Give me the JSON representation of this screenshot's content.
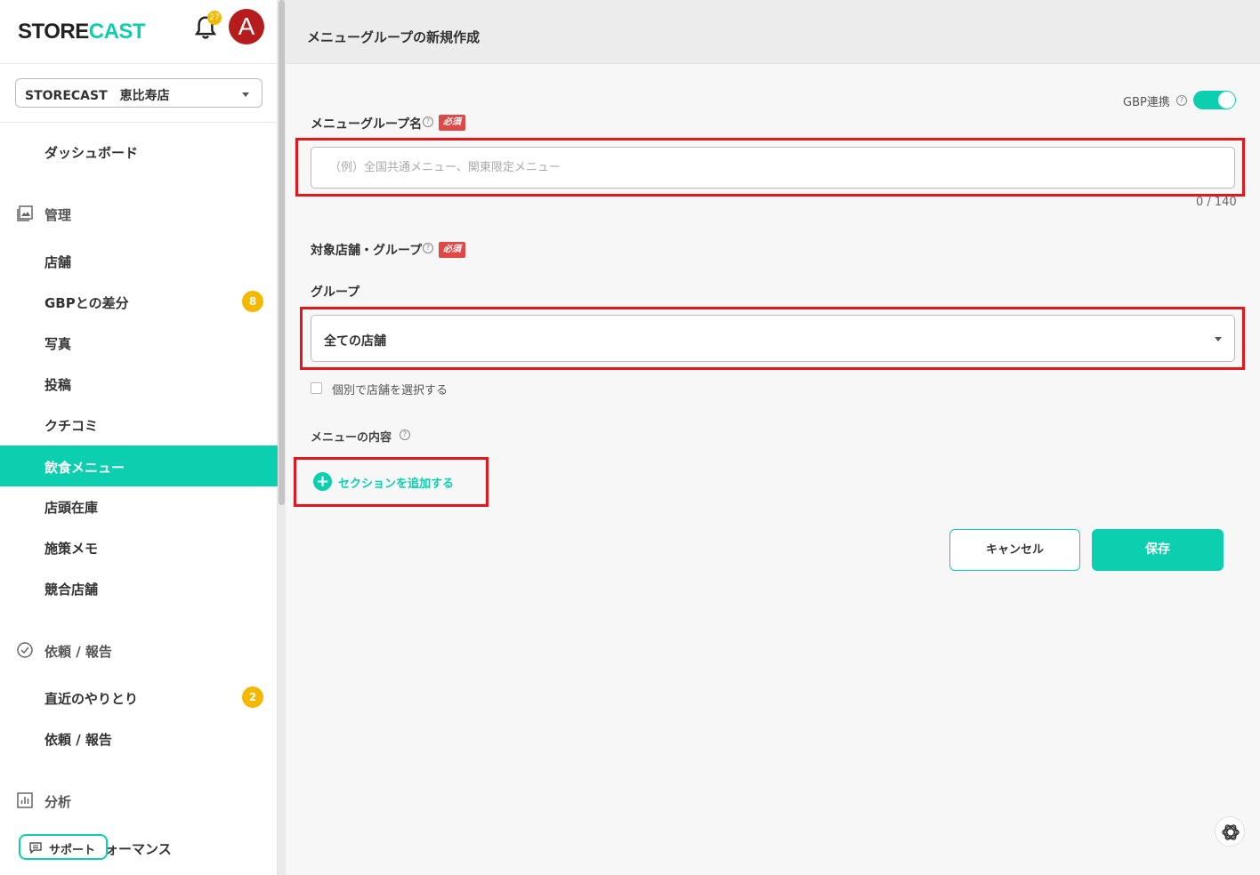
{
  "brand": {
    "part1": "STORE",
    "part2": "CAST",
    "accent": "#0ccfb0"
  },
  "notifications": {
    "count": "27"
  },
  "user": {
    "avatar_letter": "A"
  },
  "store_select": {
    "value": "STORECAST　恵比寿店"
  },
  "sidebar": {
    "dashboard": "ダッシュボード",
    "sections": [
      {
        "label": "管理",
        "icon": "image-icon"
      },
      {
        "label": "依頼 / 報告",
        "icon": "check-circle-icon"
      },
      {
        "label": "分析",
        "icon": "bar-chart-icon"
      }
    ],
    "manage_items": [
      {
        "label": "店舗"
      },
      {
        "label": "GBPとの差分",
        "badge": "8"
      },
      {
        "label": "写真"
      },
      {
        "label": "投稿"
      },
      {
        "label": "クチコミ"
      },
      {
        "label": "飲食メニュー",
        "active": true
      },
      {
        "label": "店頭在庫"
      },
      {
        "label": "施策メモ"
      },
      {
        "label": "競合店舗"
      }
    ],
    "request_items": [
      {
        "label": "直近のやりとり",
        "badge": "2"
      },
      {
        "label": "依頼 / 報告"
      }
    ],
    "analysis_items": [
      {
        "label": "ォーマンス"
      }
    ],
    "support_label": "サポート"
  },
  "header": {
    "title": "メニューグループの新規作成"
  },
  "form": {
    "gbp_link_label": "GBP連携",
    "gbp_link_on": true,
    "required_label": "必須",
    "name_label": "メニューグループ名",
    "name_placeholder": "（例）全国共通メニュー、関東限定メニュー",
    "name_counter": "0 / 140",
    "target_label": "対象店舗・グループ",
    "group_label": "グループ",
    "group_value": "全ての店舗",
    "individual_select_label": "個別で店舗を選択する",
    "menu_content_label": "メニューの内容",
    "add_section_label": "セクションを追加する",
    "cancel_label": "キャンセル",
    "save_label": "保存"
  }
}
